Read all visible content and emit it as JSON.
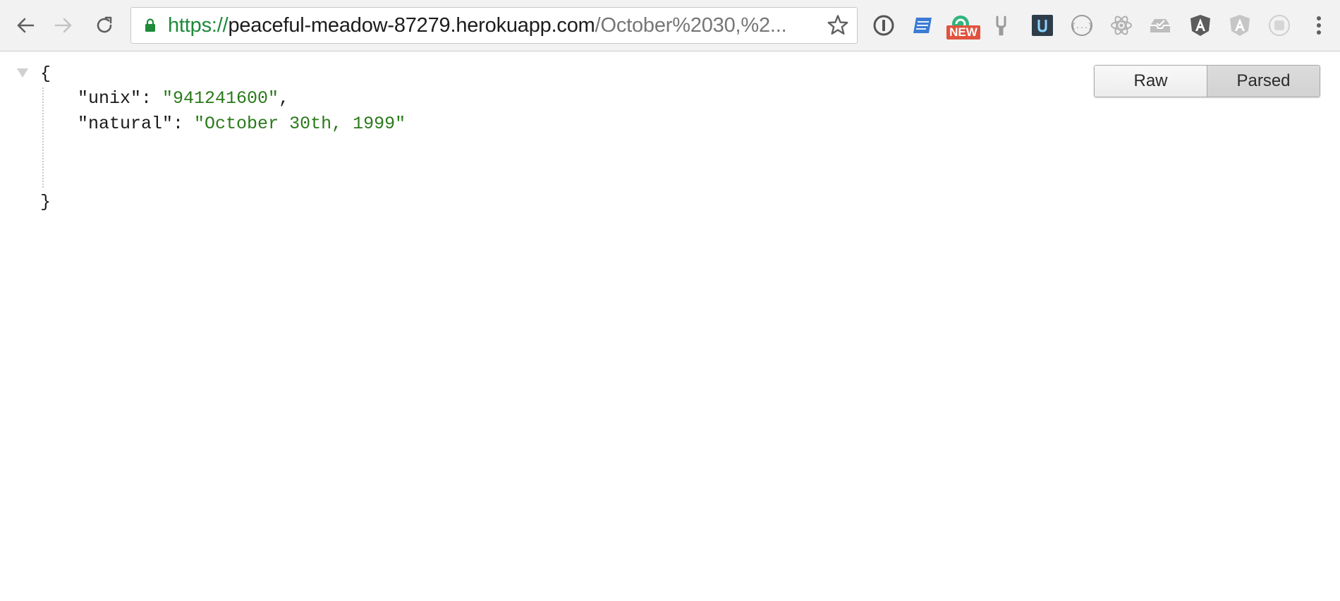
{
  "browser": {
    "url": {
      "scheme": "https://",
      "host": "peaceful-meadow-87279.herokuapp.com",
      "path": "/October%2030,%2..."
    },
    "icons": {
      "back": "arrow-left-icon",
      "forward": "arrow-right-icon",
      "reload": "reload-icon",
      "lock": "lock-icon",
      "bookmark": "star-icon",
      "menu": "vertical-dots-icon"
    },
    "extensions": [
      {
        "name": "1password-icon"
      },
      {
        "name": "blue-note-icon"
      },
      {
        "name": "grammarly-icon",
        "badge": "NEW"
      },
      {
        "name": "tuning-fork-icon"
      },
      {
        "name": "udacity-icon"
      },
      {
        "name": "json-formatter-icon"
      },
      {
        "name": "react-devtools-icon"
      },
      {
        "name": "envelope-tray-icon"
      },
      {
        "name": "angular-icon"
      },
      {
        "name": "angular-gray-icon"
      },
      {
        "name": "gray-square-icon"
      }
    ]
  },
  "viewer": {
    "json": {
      "brace_open": "{",
      "brace_close": "}",
      "entries": [
        {
          "key": "\"unix\"",
          "value": "\"941241600\"",
          "trailer": ","
        },
        {
          "key": "\"natural\"",
          "value": "\"October 30th, 1999\"",
          "trailer": ""
        }
      ],
      "separator": ": "
    },
    "toggle": {
      "raw_label": "Raw",
      "parsed_label": "Parsed",
      "active": "Parsed"
    }
  },
  "colors": {
    "url_scheme": "#1e8a3a",
    "string_value": "#2a7a1a",
    "new_badge": "#e0533e"
  }
}
